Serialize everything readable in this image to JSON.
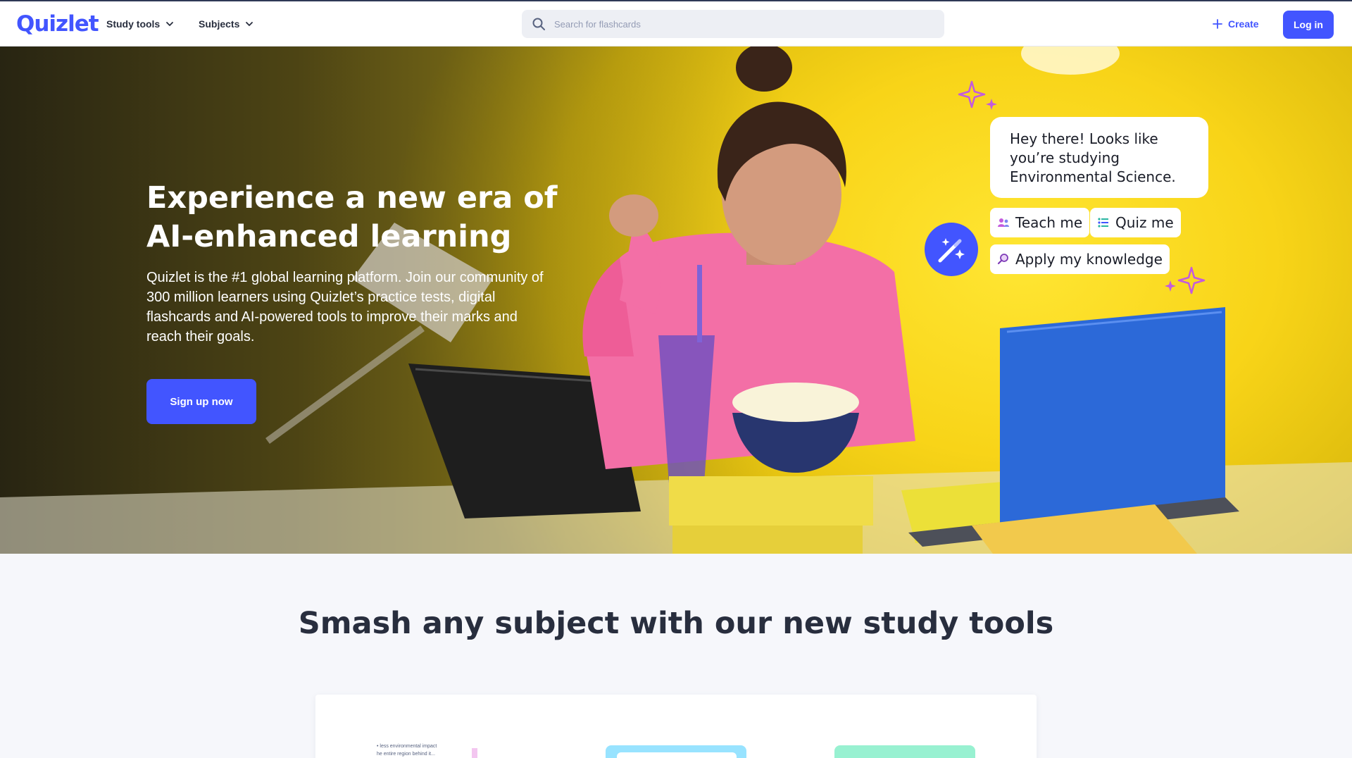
{
  "header": {
    "logo": "Quizlet",
    "nav": [
      {
        "label": "Study tools"
      },
      {
        "label": "Subjects"
      }
    ],
    "search_placeholder": "Search for flashcards",
    "create_label": "Create",
    "login_label": "Log in"
  },
  "hero": {
    "title": "Experience a new era of AI-enhanced learning",
    "description": "Quizlet is the #1 global learning platform. Join our community of 300 million learners using Quizlet’s practice tests, digital flashcards and AI-powered tools to improve their marks and reach their goals.",
    "cta_label": "Sign up now",
    "chat": {
      "message": "Hey there! Looks like you’re studying Environmental Science.",
      "chips": [
        {
          "label": "Teach me",
          "icon": "people-icon"
        },
        {
          "label": "Quiz me",
          "icon": "list-icon"
        },
        {
          "label": "Apply my knowledge",
          "icon": "magnifier-icon"
        }
      ]
    }
  },
  "section": {
    "title": "Smash any subject with our new study tools",
    "preview_snippet": [
      "• less environmental impact",
      "he entire region behind it..."
    ]
  },
  "colors": {
    "brand": "#4255ff",
    "hero_yellow": "#f8d418",
    "sparkle": "#c35bde"
  }
}
